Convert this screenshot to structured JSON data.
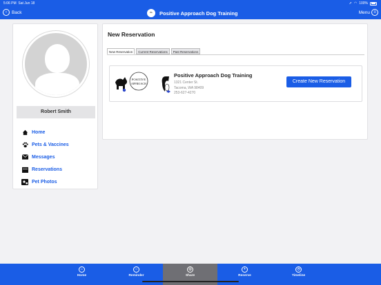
{
  "status_bar": {
    "time": "5:06 PM",
    "date": "Sat Jun 18",
    "battery": "100%"
  },
  "nav": {
    "back_label": "Back",
    "title": "Positive Approach Dog Training",
    "menu_label": "Menu"
  },
  "profile": {
    "name": "Robert Smith",
    "menu": [
      {
        "label": "Home",
        "icon": "home-icon"
      },
      {
        "label": "Pets & Vaccines",
        "icon": "paw-icon"
      },
      {
        "label": "Messages",
        "icon": "envelope-icon"
      },
      {
        "label": "Reservations",
        "icon": "calendar-icon"
      },
      {
        "label": "Pet Photos",
        "icon": "photo-icon"
      }
    ]
  },
  "main": {
    "title": "New Reservation",
    "tabs": [
      "New Reservation",
      "Current Reservations",
      "Past Reservations"
    ],
    "business": {
      "name": "Positive Approach Dog Training",
      "address_line1": "1321 Center St.",
      "address_line2": "Tacoma, WA 98409",
      "phone": "253-627-4270",
      "logo_text_1": "POSITIVE",
      "logo_text_2": "APPROACH"
    },
    "create_button": "Create New Reservation"
  },
  "tabbar": [
    {
      "label": "Home",
      "icon": "home-icon"
    },
    {
      "label": "Reminder",
      "icon": "reminder-icon"
    },
    {
      "label": "Share",
      "icon": "share-icon"
    },
    {
      "label": "Reserve",
      "icon": "plus-icon"
    },
    {
      "label": "Timeline",
      "icon": "timeline-icon"
    }
  ],
  "colors": {
    "primary": "#1a5de6",
    "active_tab": "#6f6f74",
    "background": "#f2f2f4"
  }
}
